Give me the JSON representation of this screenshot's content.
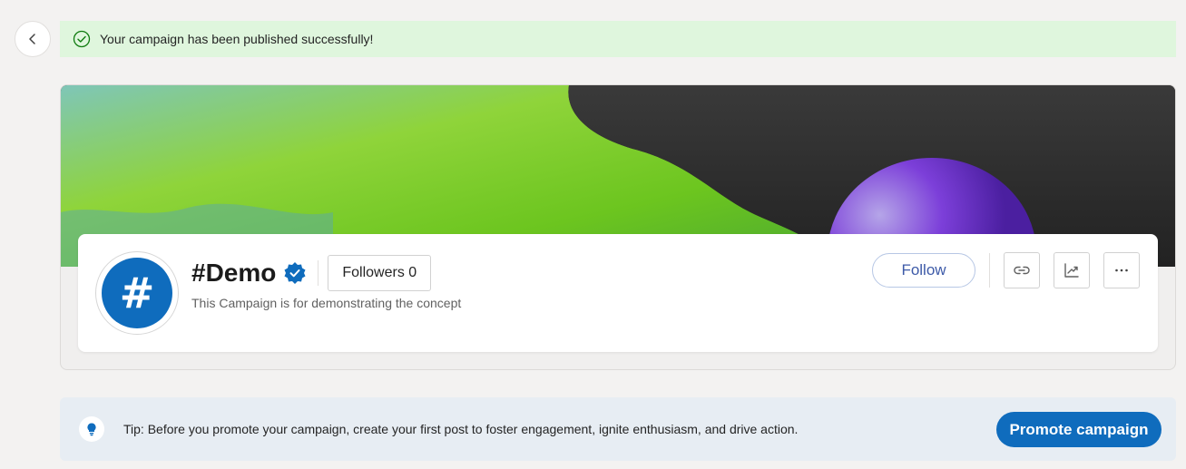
{
  "notification": {
    "message": "Your campaign has been published successfully!",
    "icon": "check-circle-icon",
    "color": "#dff6dd"
  },
  "navigation": {
    "back_icon": "chevron-left-icon"
  },
  "campaign": {
    "title": "#Demo",
    "avatar_symbol": "#",
    "verified_icon": "verified-badge-icon",
    "followers_label": "Followers 0",
    "description": "This Campaign is for demonstrating the concept"
  },
  "actions": {
    "follow_label": "Follow",
    "copy_link_icon": "link-icon",
    "analytics_icon": "trend-chart-icon",
    "more_icon": "more-horizontal-icon"
  },
  "tip": {
    "icon": "lightbulb-icon",
    "text": "Tip: Before you promote your campaign, create your first post to foster engagement, ignite enthusiasm, and drive action.",
    "promote_label": "Promote campaign"
  },
  "colors": {
    "brand_blue": "#0f6cbd",
    "success_bg": "#dff6dd",
    "tip_bg": "#e7edf3"
  }
}
